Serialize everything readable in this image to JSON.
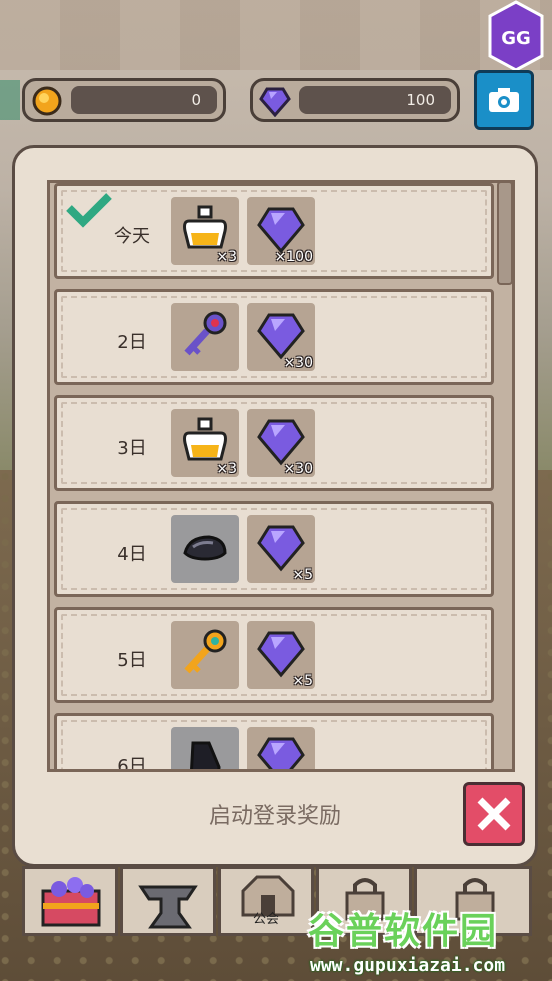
{
  "currency": {
    "gold": {
      "icon": "gold-coin-icon",
      "value": "0"
    },
    "gems": {
      "icon": "purple-gem-icon",
      "value": "100"
    }
  },
  "top_buttons": {
    "camera": "camera-icon",
    "logo": "GG"
  },
  "panel": {
    "title": "启动登录奖励",
    "close": "close-icon",
    "rows": [
      {
        "day": "今天",
        "claimed": true,
        "reward1": {
          "icon": "potion-icon",
          "qty": "×3"
        },
        "reward2": {
          "icon": "purple-gem-icon",
          "qty": "×100"
        }
      },
      {
        "day": "2日",
        "claimed": false,
        "reward1": {
          "icon": "purple-key-icon",
          "qty": ""
        },
        "reward2": {
          "icon": "purple-gem-icon",
          "qty": "×30"
        }
      },
      {
        "day": "3日",
        "claimed": false,
        "reward1": {
          "icon": "potion-icon",
          "qty": "×3"
        },
        "reward2": {
          "icon": "purple-gem-icon",
          "qty": "×30"
        }
      },
      {
        "day": "4日",
        "claimed": false,
        "reward1": {
          "icon": "ore-icon",
          "qty": ""
        },
        "reward2": {
          "icon": "purple-gem-icon",
          "qty": "×5"
        }
      },
      {
        "day": "5日",
        "claimed": false,
        "reward1": {
          "icon": "gold-key-icon",
          "qty": ""
        },
        "reward2": {
          "icon": "purple-gem-icon",
          "qty": "×5"
        }
      },
      {
        "day": "6日",
        "claimed": false,
        "reward1": {
          "icon": "dark-bag-icon",
          "qty": ""
        },
        "reward2": {
          "icon": "purple-gem-icon",
          "qty": ""
        }
      }
    ]
  },
  "bottom_nav": [
    {
      "icon": "treasure-chest-icon",
      "label": ""
    },
    {
      "icon": "anvil-icon",
      "label": ""
    },
    {
      "icon": "guild-hall-icon",
      "label": "公会"
    },
    {
      "icon": "locked-icon",
      "label": ""
    },
    {
      "icon": "locked-icon",
      "label": ""
    }
  ],
  "watermark": {
    "cn": "谷普软件园",
    "url": "www.gupuxiazai.com"
  },
  "colors": {
    "panel_bg": "#e9dfd2",
    "close_red": "#e34d68",
    "camera_blue": "#1a8fc8",
    "check_green": "#2fa882"
  }
}
